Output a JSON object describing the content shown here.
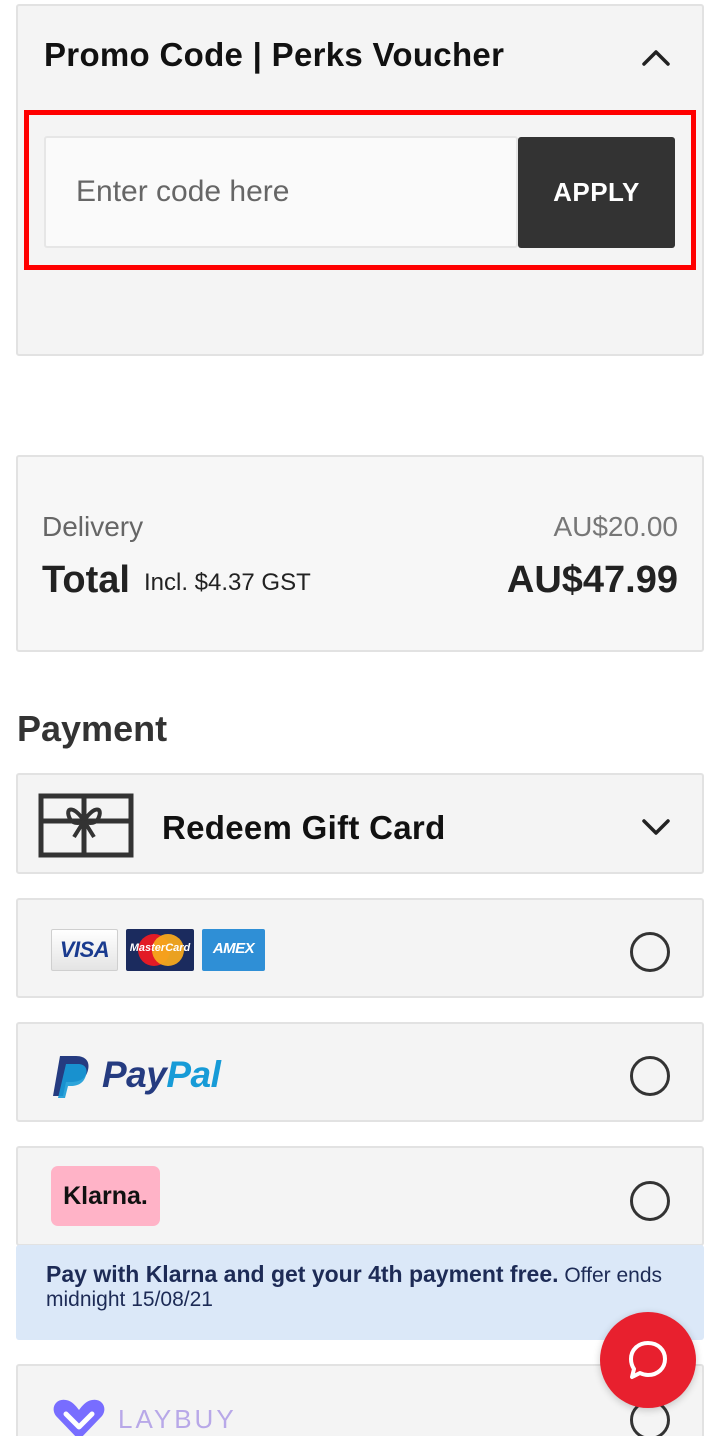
{
  "promo": {
    "title": "Promo Code | Perks Voucher",
    "input_placeholder": "Enter code here",
    "apply_label": "APPLY",
    "toggle_icon": "chevron-up-icon"
  },
  "summary": {
    "delivery_label": "Delivery",
    "delivery_value": "AU$20.00",
    "total_label": "Total",
    "total_note": "Incl. $4.37 GST",
    "total_value": "AU$47.99"
  },
  "payment": {
    "title": "Payment",
    "gift_card": {
      "label": "Redeem Gift Card",
      "icon": "gift-card-icon",
      "toggle_icon": "chevron-down-icon"
    },
    "cards": {
      "visa": "VISA",
      "mastercard": "MasterCard",
      "amex": "AMEX"
    },
    "paypal": {
      "pay": "Pay",
      "pal": "Pal"
    },
    "klarna": {
      "badge": "Klarna.",
      "promo_bold": "Pay with Klarna and get your 4th payment free.",
      "promo_rest": " Offer ends midnight 15/08/21"
    },
    "laybuy": {
      "label": "LAYBUY"
    }
  },
  "colors": {
    "apply_bg": "#333333",
    "highlight": "#ff0000",
    "klarna_pink": "#ffb3c7",
    "klarna_promo_bg": "#dbe8f8",
    "chat_red": "#e8202e",
    "paypal_dark": "#253b80",
    "paypal_light": "#179bd7",
    "laybuy_purple": "#786dff"
  },
  "chat": {
    "icon": "chat-bubble-icon"
  }
}
